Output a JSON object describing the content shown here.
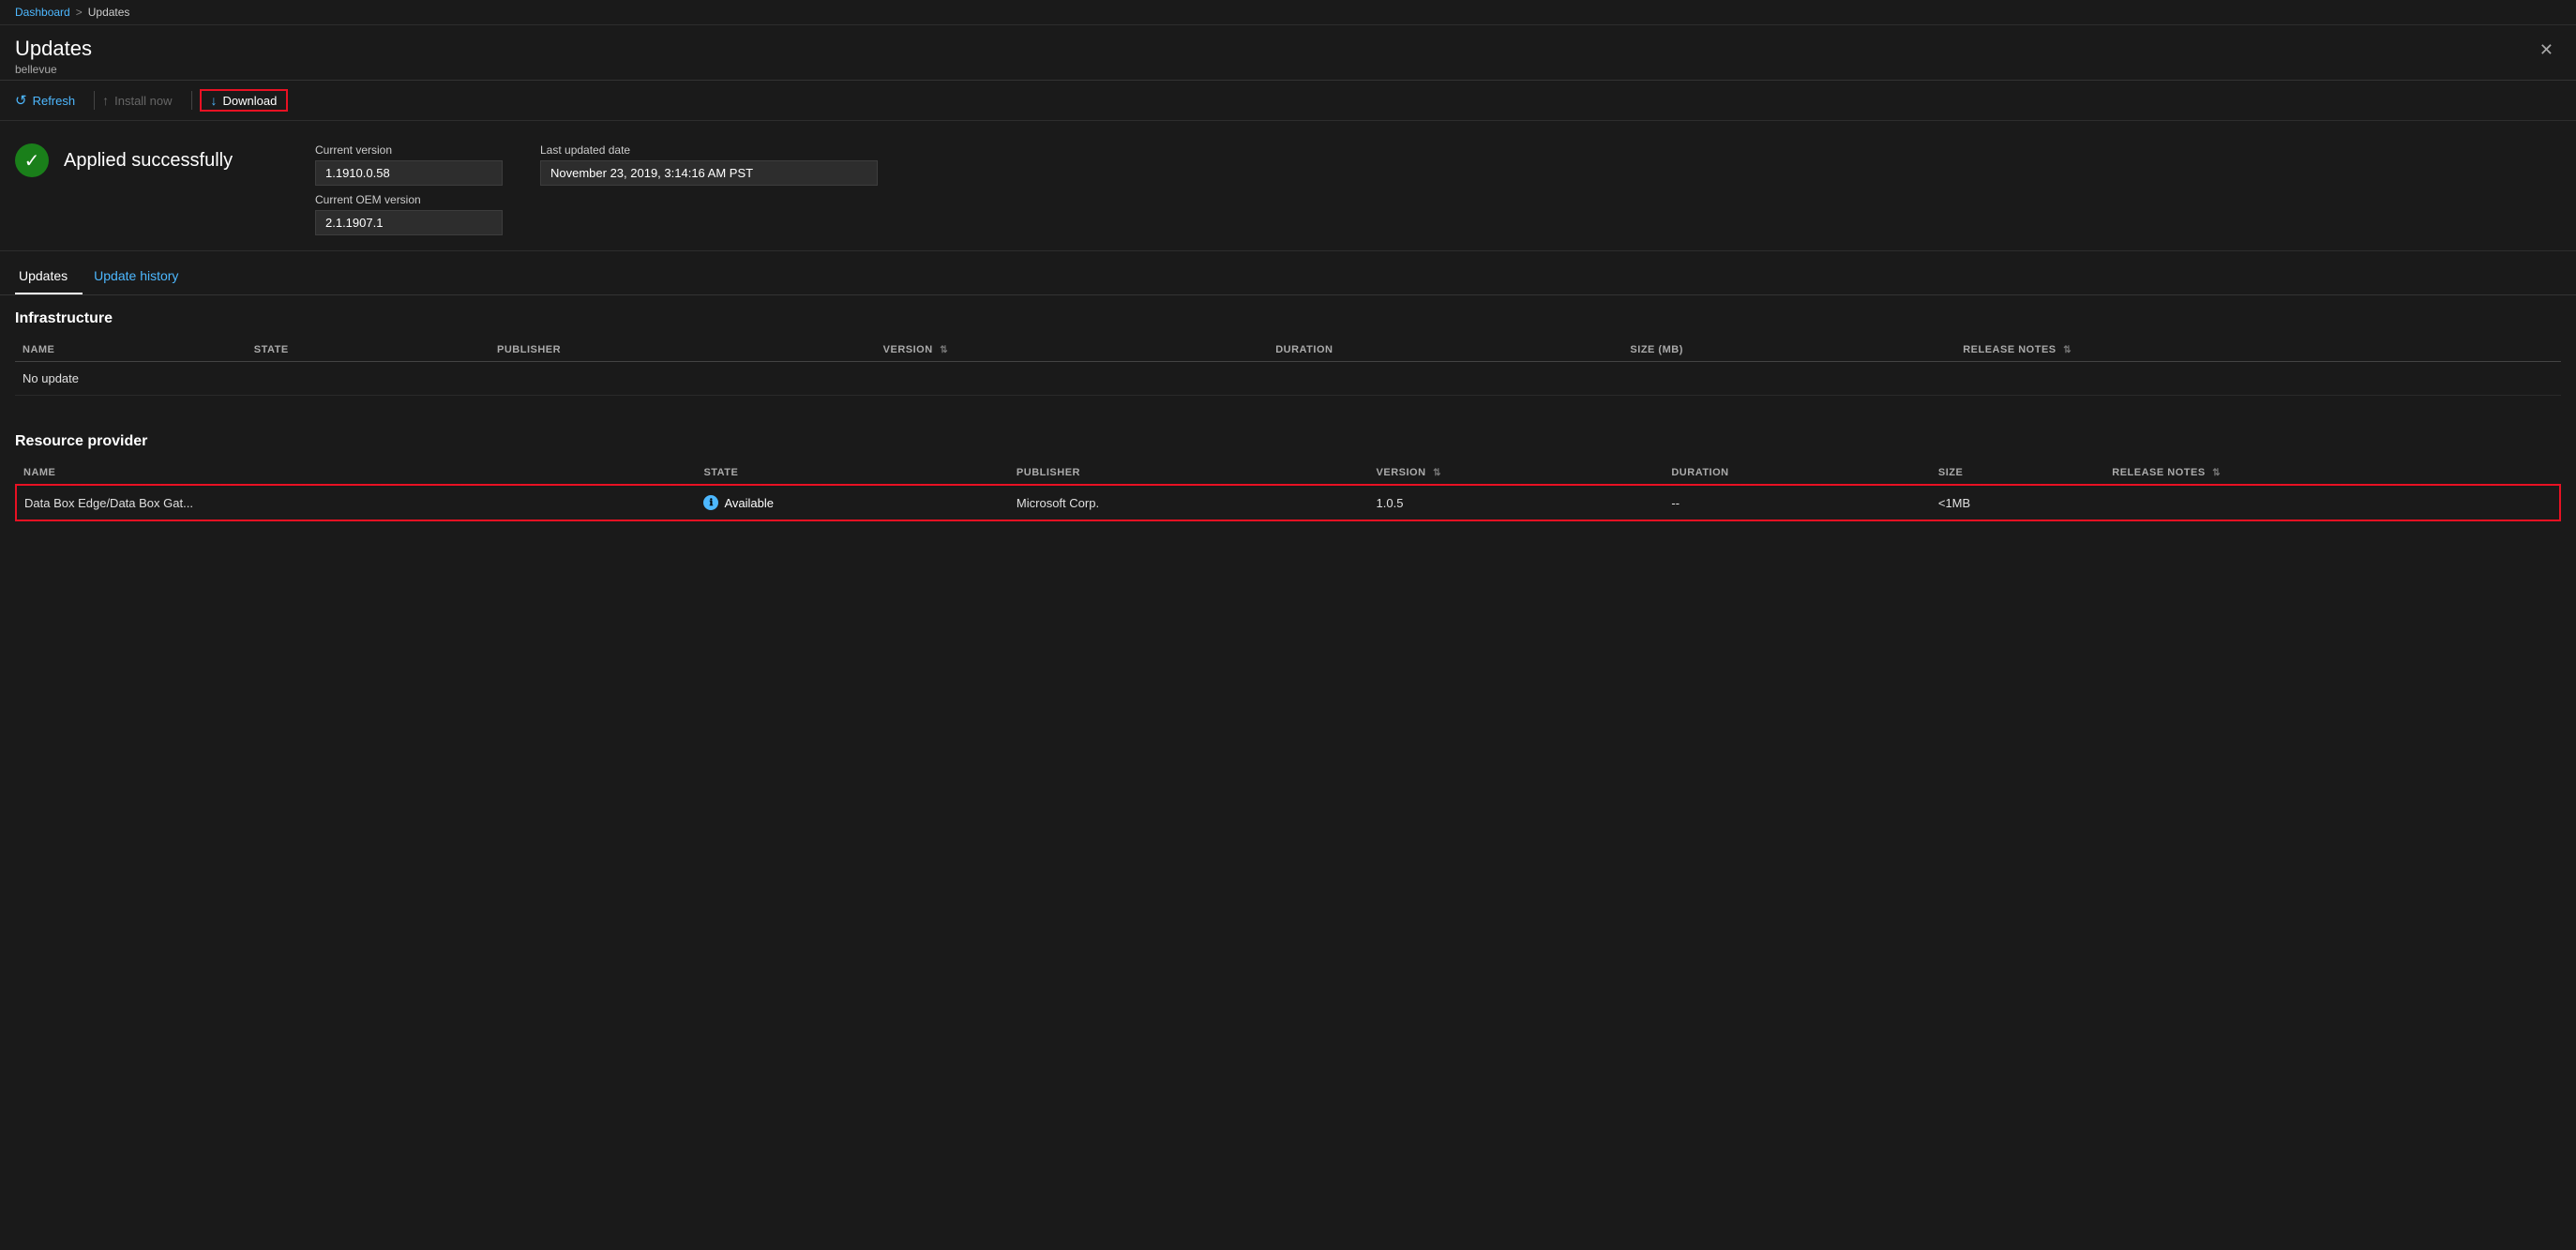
{
  "breadcrumb": {
    "dashboard_label": "Dashboard",
    "separator": ">",
    "current_label": "Updates"
  },
  "header": {
    "title": "Updates",
    "subtitle": "bellevue",
    "close_label": "✕"
  },
  "toolbar": {
    "refresh_label": "Refresh",
    "install_label": "Install now",
    "download_label": "Download"
  },
  "status": {
    "icon": "✓",
    "text": "Applied successfully",
    "current_version_label": "Current version",
    "current_version_value": "1.1910.0.58",
    "current_oem_label": "Current OEM version",
    "current_oem_value": "2.1.1907.1",
    "last_updated_label": "Last updated date",
    "last_updated_value": "November 23, 2019, 3:14:16 AM PST"
  },
  "tabs": [
    {
      "label": "Updates",
      "active": true
    },
    {
      "label": "Update history",
      "active": false
    }
  ],
  "infrastructure": {
    "section_title": "Infrastructure",
    "columns": [
      {
        "label": "NAME",
        "sortable": false
      },
      {
        "label": "STATE",
        "sortable": false
      },
      {
        "label": "PUBLISHER",
        "sortable": false
      },
      {
        "label": "VERSION",
        "sortable": true
      },
      {
        "label": "DURATION",
        "sortable": false
      },
      {
        "label": "SIZE (MB)",
        "sortable": false
      },
      {
        "label": "RELEASE NOTES",
        "sortable": true
      }
    ],
    "rows": [
      {
        "name": "No update",
        "state": "",
        "publisher": "",
        "version": "",
        "duration": "",
        "size": "",
        "release_notes": ""
      }
    ],
    "no_update_text": "No update"
  },
  "resource_provider": {
    "section_title": "Resource provider",
    "columns": [
      {
        "label": "NAME",
        "sortable": false
      },
      {
        "label": "STATE",
        "sortable": false
      },
      {
        "label": "PUBLISHER",
        "sortable": false
      },
      {
        "label": "VERSION",
        "sortable": true
      },
      {
        "label": "DURATION",
        "sortable": false
      },
      {
        "label": "SIZE",
        "sortable": false
      },
      {
        "label": "RELEASE NOTES",
        "sortable": true
      }
    ],
    "rows": [
      {
        "name": "Data Box Edge/Data Box Gat...",
        "state": "Available",
        "publisher": "Microsoft Corp.",
        "version": "1.0.5",
        "duration": "--",
        "size": "<1MB",
        "release_notes": "",
        "selected": true
      }
    ]
  },
  "colors": {
    "accent_blue": "#4db8ff",
    "selected_red": "#e81123",
    "success_green": "#1a7f1a",
    "bg_dark": "#1a1a1a",
    "bg_field": "#2d2d2d"
  }
}
